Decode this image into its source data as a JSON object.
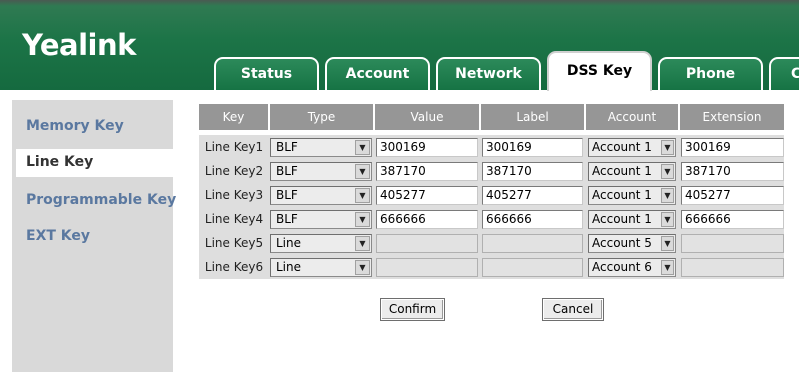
{
  "app": {
    "logo": "Yealink"
  },
  "tabs": [
    {
      "label": "Status"
    },
    {
      "label": "Account"
    },
    {
      "label": "Network"
    },
    {
      "label": "DSS Key"
    },
    {
      "label": "Phone"
    },
    {
      "label": "C"
    }
  ],
  "active_tab": "DSS Key",
  "sidebar": {
    "items": [
      {
        "label": "Memory Key"
      },
      {
        "label": "Line Key"
      },
      {
        "label": "Programmable Key"
      },
      {
        "label": "EXT Key"
      }
    ],
    "active": "Line Key"
  },
  "table": {
    "headers": [
      "Key",
      "Type",
      "Value",
      "Label",
      "Account",
      "Extension"
    ],
    "rows": [
      {
        "key": "Line Key1",
        "type": "BLF",
        "value": "300169",
        "label": "300169",
        "account": "Account 1",
        "extension": "300169",
        "enabled": true
      },
      {
        "key": "Line Key2",
        "type": "BLF",
        "value": "387170",
        "label": "387170",
        "account": "Account 1",
        "extension": "387170",
        "enabled": true
      },
      {
        "key": "Line Key3",
        "type": "BLF",
        "value": "405277",
        "label": "405277",
        "account": "Account 1",
        "extension": "405277",
        "enabled": true
      },
      {
        "key": "Line Key4",
        "type": "BLF",
        "value": "666666",
        "label": "666666",
        "account": "Account 1",
        "extension": "666666",
        "enabled": true
      },
      {
        "key": "Line Key5",
        "type": "Line",
        "value": "",
        "label": "",
        "account": "Account 5",
        "extension": "",
        "enabled": false
      },
      {
        "key": "Line Key6",
        "type": "Line",
        "value": "",
        "label": "",
        "account": "Account 6",
        "extension": "",
        "enabled": false
      }
    ]
  },
  "buttons": {
    "confirm": "Confirm",
    "cancel": "Cancel"
  },
  "icons": {
    "dropdown": "chevron-down-icon"
  }
}
